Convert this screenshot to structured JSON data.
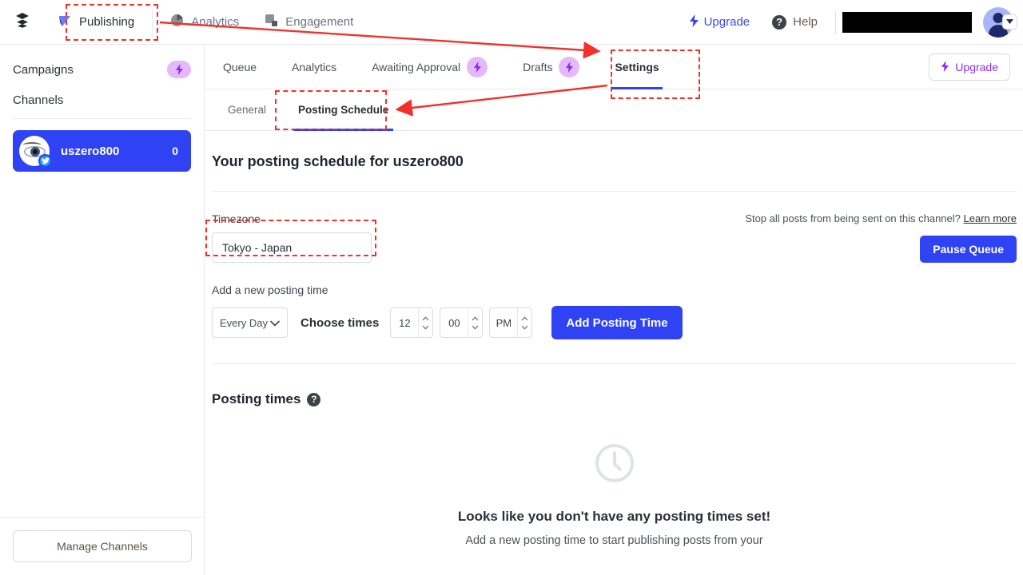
{
  "topbar": {
    "logo_icon": "layers-icon",
    "nav": [
      {
        "label": "Publishing",
        "icon": "publishing-icon",
        "active": true
      },
      {
        "label": "Analytics",
        "icon": "pie-chart-icon",
        "active": false
      },
      {
        "label": "Engagement",
        "icon": "engagement-icon",
        "active": false
      }
    ],
    "upgrade_label": "Upgrade",
    "upgrade_icon": "bolt-icon",
    "help_label": "Help",
    "help_icon": "question-circle-icon",
    "account_name_redacted": "",
    "avatar_icon": "user-avatar",
    "avatar_caret_icon": "chevron-down-icon"
  },
  "sidebar": {
    "campaigns_label": "Campaigns",
    "campaigns_badge_icon": "bolt-icon",
    "channels_label": "Channels",
    "channels": [
      {
        "name": "uszero800",
        "count": "0",
        "network_icon": "twitter-icon",
        "selected": true
      }
    ],
    "manage_channels_label": "Manage Channels"
  },
  "content": {
    "tabs": [
      {
        "label": "Queue",
        "badge": false,
        "active": false
      },
      {
        "label": "Analytics",
        "badge": false,
        "active": false
      },
      {
        "label": "Awaiting Approval",
        "badge": true,
        "active": false
      },
      {
        "label": "Drafts",
        "badge": true,
        "active": false
      },
      {
        "label": "Settings",
        "badge": false,
        "active": true
      }
    ],
    "upgrade_label": "Upgrade",
    "upgrade_icon": "bolt-icon",
    "subtabs": [
      {
        "label": "General",
        "active": false
      },
      {
        "label": "Posting Schedule",
        "active": true
      }
    ],
    "page_title": "Your posting schedule for uszero800",
    "timezone": {
      "label": "Timezone",
      "value": "Tokyo - Japan"
    },
    "pause": {
      "note": "Stop all posts from being sent on this channel?",
      "learn_more": "Learn more",
      "button_label": "Pause Queue"
    },
    "add_posting_time": {
      "label": "Add a new posting time",
      "day_value": "Every Day",
      "day_caret_icon": "chevron-down-icon",
      "choose_times_label": "Choose times",
      "hour": "12",
      "minute": "00",
      "meridiem": "PM",
      "button_label": "Add Posting Time"
    },
    "posting_times": {
      "heading": "Posting times",
      "help_icon": "question-circle-icon",
      "empty_icon": "clock-icon",
      "empty_title": "Looks like you don't have any posting times set!",
      "empty_subtitle": "Add a new posting time to start publishing posts from your"
    }
  },
  "colors": {
    "brand_blue": "#2f43f4",
    "accent_purple": "#8b2ef0",
    "badge_purple": "#e4b9fb",
    "annotation_red": "#f0312b",
    "twitter_blue": "#1da1f2"
  }
}
